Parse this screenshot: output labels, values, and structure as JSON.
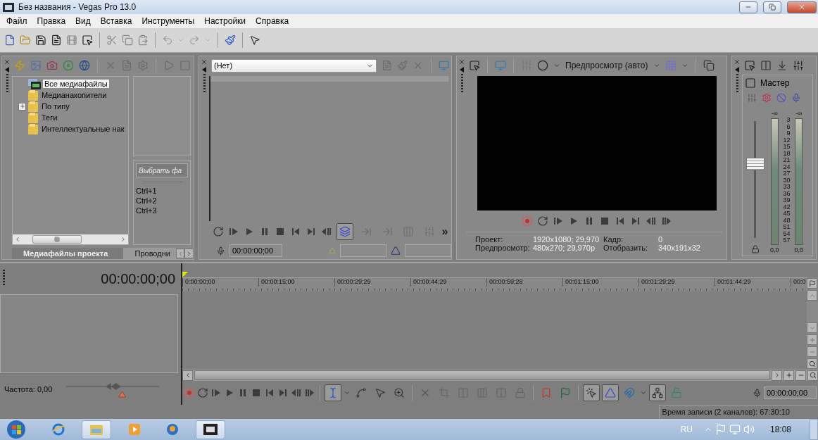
{
  "window": {
    "title": "Без названия - Vegas Pro 13.0"
  },
  "menu": [
    "Файл",
    "Правка",
    "Вид",
    "Вставка",
    "Инструменты",
    "Настройки",
    "Справка"
  ],
  "media": {
    "tree": [
      {
        "label": "Все медиафайлы",
        "kind": "media",
        "selected": true,
        "expander": false
      },
      {
        "label": "Медианакопители",
        "kind": "folder",
        "selected": false,
        "expander": false
      },
      {
        "label": "По типу",
        "kind": "folder",
        "selected": false,
        "expander": true
      },
      {
        "label": "Теги",
        "kind": "folder",
        "selected": false,
        "expander": false
      },
      {
        "label": "Интеллектуальные нак",
        "kind": "folder",
        "selected": false,
        "expander": false
      }
    ],
    "select_button": {
      "label": "Выбрать фа",
      "disabled": true
    },
    "shortcuts": [
      "Ctrl+1",
      "Ctrl+2",
      "Ctrl+3"
    ],
    "tabs": [
      {
        "label": "Медиафайлы проекта",
        "selected": true
      },
      {
        "label": "Проводни",
        "selected": false
      }
    ]
  },
  "trimmer": {
    "source": "(Нет)",
    "tools": [
      {
        "pressed": true
      },
      {
        "pressed": false
      },
      {
        "pressed": false
      },
      {
        "pressed": false
      },
      {
        "pressed": false
      }
    ],
    "more": "»",
    "time": "00:00:00;00"
  },
  "preview": {
    "mode": "Предпросмотр (авто)",
    "info": [
      {
        "label": "Проект:",
        "value": "1920x1080; 29,970"
      },
      {
        "label": "Кадр:",
        "value": "0"
      },
      {
        "label": "Предпросмотр:",
        "value": "480x270; 29,970p"
      },
      {
        "label": "Отобразить:",
        "value": "340x191x32"
      }
    ]
  },
  "mixer": {
    "title": "Мастер",
    "level": 0.63,
    "peaks": [
      "-∞",
      "-∞"
    ],
    "scale": [
      "3",
      "6",
      "9",
      "12",
      "15",
      "18",
      "21",
      "24",
      "27",
      "30",
      "33",
      "36",
      "39",
      "42",
      "45",
      "48",
      "51",
      "54",
      "57"
    ],
    "readings": [
      "0,0",
      "0,0"
    ]
  },
  "timeline": {
    "time": "00:00:00;00",
    "ruler": [
      "0:00:00;00",
      "00:00:15;00",
      "00:00:29;29",
      "00:00:44;29",
      "00:00:59;28",
      "00:01:15;00",
      "00:01:29;29",
      "00:01:44;29",
      "00:0"
    ],
    "rate": "Частота: 0,00",
    "rate_slider": {
      "level": 0.55
    },
    "tools": [
      {
        "pressed": true
      },
      {
        "pressed": false
      },
      {
        "pressed": false
      },
      {
        "pressed": false
      },
      {
        "pressed": false
      },
      {
        "pressed": false
      },
      {
        "pressed": false
      },
      {
        "pressed": false
      },
      {
        "pressed": false
      },
      {
        "pressed": false
      },
      {
        "pressed": false
      },
      {
        "pressed": false
      },
      {
        "pressed": true
      },
      {
        "pressed": true
      },
      {
        "pressed": false
      },
      {
        "pressed": true
      },
      {
        "pressed": false
      }
    ],
    "cursor_time": "00:00:00;00",
    "status": "Время записи (2 каналов): 67:30:10"
  },
  "taskbar": {
    "apps": [
      {
        "open": false
      },
      {
        "open": true
      },
      {
        "open": false
      },
      {
        "open": false
      },
      {
        "open": true
      }
    ],
    "language": "RU",
    "clock": "18:08"
  }
}
